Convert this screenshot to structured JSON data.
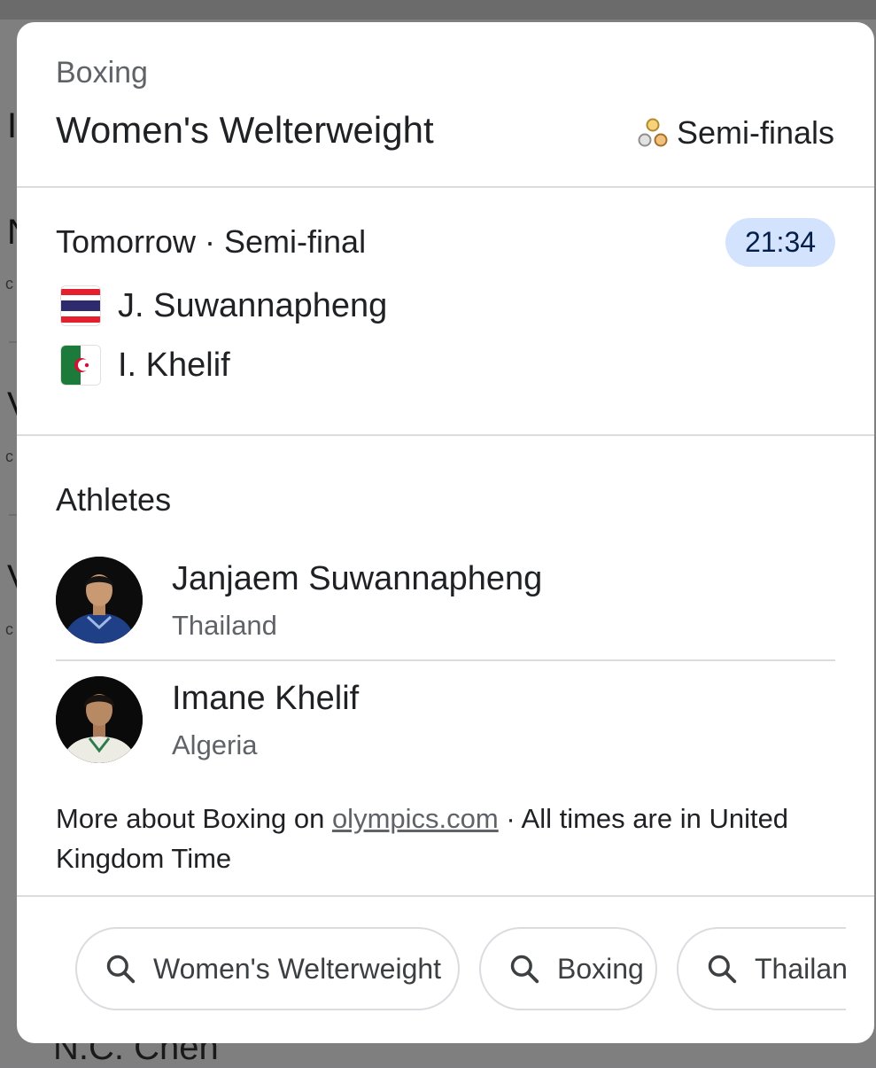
{
  "card": {
    "sport": "Boxing",
    "event": "Women's Welterweight",
    "stage": "Semi-finals",
    "stage_icon": "medals-icon"
  },
  "match": {
    "heading": "Tomorrow · Semi-final",
    "time": "21:34",
    "competitors": [
      {
        "name": "J. Suwannapheng",
        "flag": "thailand-flag"
      },
      {
        "name": "I. Khelif",
        "flag": "algeria-flag"
      }
    ]
  },
  "athletes": {
    "title": "Athletes",
    "items": [
      {
        "name": "Janjaem Suwannapheng",
        "country": "Thailand"
      },
      {
        "name": "Imane Khelif",
        "country": "Algeria"
      }
    ]
  },
  "footer": {
    "prefix": "More about Boxing on ",
    "link": "olympics.com",
    "suffix": " · All times are in United Kingdom Time"
  },
  "chips": [
    {
      "label": "Women's Welterweight",
      "icon": "search-icon"
    },
    {
      "label": "Boxing",
      "icon": "search-icon"
    },
    {
      "label": "Thailand",
      "icon": "search-icon"
    }
  ],
  "background": {
    "bottom_text": "N.C. Chen"
  },
  "colors": {
    "time_chip_bg": "#d3e3fd",
    "link": "#5f6368",
    "divider": "#dadce0"
  }
}
